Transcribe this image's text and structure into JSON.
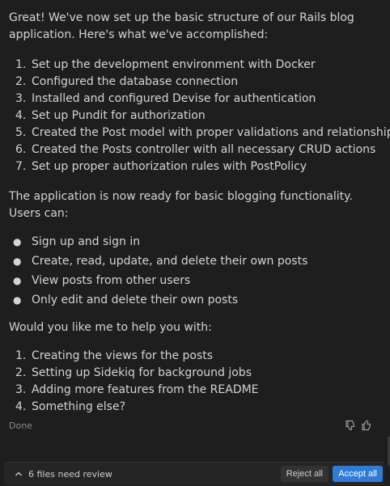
{
  "message": {
    "intro": "Great! We've now set up the basic structure of our Rails blog application. Here's what we've accomplished:",
    "steps": [
      "Set up the development environment with Docker",
      "Configured the database connection",
      "Installed and configured Devise for authentication",
      "Set up Pundit for authorization",
      "Created the Post model with proper validations and relationships",
      "Created the Posts controller with all necessary CRUD actions",
      "Set up proper authorization rules with PostPolicy"
    ],
    "ready_text": "The application is now ready for basic blogging functionality. Users can:",
    "abilities": [
      "Sign up and sign in",
      "Create, read, update, and delete their own posts",
      "View posts from other users",
      "Only edit and delete their own posts"
    ],
    "question": "Would you like me to help you with:",
    "options": [
      "Creating the views for the posts",
      "Setting up Sidekiq for background jobs",
      "Adding more features from the README",
      "Something else?"
    ]
  },
  "status": {
    "label": "Done",
    "thumbs_down_icon": "thumbs-down-icon",
    "thumbs_up_icon": "thumbs-up-icon"
  },
  "review_bar": {
    "chevron_icon": "chevron-up-icon",
    "text": "6 files need review",
    "reject_label": "Reject all",
    "accept_label": "Accept all"
  },
  "colors": {
    "background": "#1e1e1e",
    "text": "#d4d4d4",
    "accent": "#2f7bd6"
  }
}
